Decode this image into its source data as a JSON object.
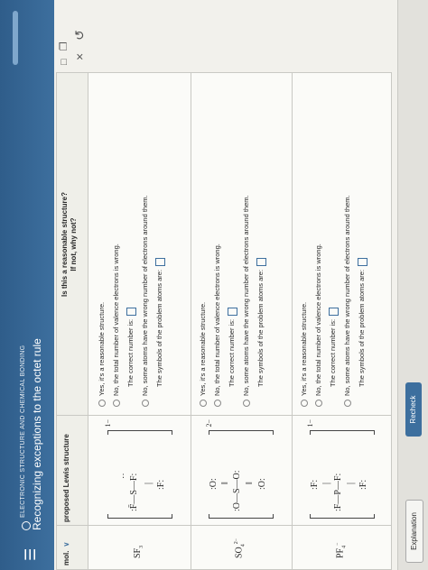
{
  "header": {
    "topic": "ELECTRONIC STRUCTURE AND CHEMICAL BONDING",
    "title": "Recognizing exceptions to the octet rule",
    "menu_icon": "☰"
  },
  "toolbar": {
    "expand_icon": "□",
    "copy_icon": "❐",
    "close_icon": "×",
    "undo_icon": "↺"
  },
  "table": {
    "headers": {
      "molecule": "mol.",
      "lewis": "proposed Lewis structure",
      "question": "Is this a reasonable structure?",
      "question_sub": "If not, why not?"
    },
    "rows": [
      {
        "molecule": "SF",
        "molecule_sub": "3",
        "molecule_sup": "",
        "charge": "1−",
        "lewis": {
          "left": ":F̄—S—F:",
          "center_dots": "‥",
          "bottom": ":F:"
        },
        "options": {
          "yes": "Yes, it's a reasonable structure.",
          "no_total": "No, the total number of valence electrons is wrong.",
          "correct_number": "The correct number is:",
          "no_some": "No, some atoms have the wrong number of electrons around them.",
          "symbols": "The symbols of the problem atoms are:"
        }
      },
      {
        "molecule": "SO",
        "molecule_sub": "4",
        "molecule_sup": "2−",
        "charge": "2−",
        "lewis": {
          "left": ":O—S—O:",
          "top": ":O:",
          "bottom": ":O:"
        },
        "options": {
          "yes": "Yes, it's a reasonable structure.",
          "no_total": "No, the total number of valence electrons is wrong.",
          "correct_number": "The correct number is:",
          "no_some": "No, some atoms have the wrong number of electrons around them.",
          "symbols": "The symbols of the problem atoms are:"
        }
      },
      {
        "molecule": "PF",
        "molecule_sub": "4",
        "molecule_sup": "−",
        "charge": "1−",
        "lewis": {
          "left": ":F—P—F:",
          "top": ":F:",
          "bottom": ":F:"
        },
        "options": {
          "yes": "Yes, it's a reasonable structure.",
          "no_total": "No, the total number of valence electrons is wrong.",
          "correct_number": "The correct number is:",
          "no_some": "No, some atoms have the wrong number of electrons around them.",
          "symbols": "The symbols of the problem atoms are:"
        }
      }
    ]
  },
  "bottom": {
    "explanation": "Explanation",
    "recheck": "Recheck"
  }
}
